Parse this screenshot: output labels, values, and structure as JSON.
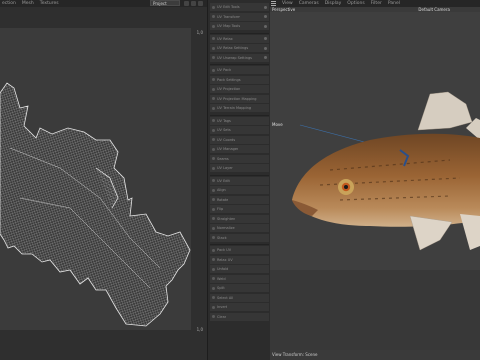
{
  "uv_editor": {
    "menu": [
      "ection",
      "Mesh",
      "Textures"
    ],
    "project_select": "Project",
    "corner_labels": {
      "top_right": "1,0",
      "bottom_right": "1,0"
    }
  },
  "side_panel": {
    "items": [
      "UV Edit Tools",
      "UV Transform",
      "UV Map Tools",
      "UV Relax",
      "UV Relax Settings",
      "UV Unwrap Settings",
      "UV Pack",
      "Pack Settings",
      "UV Projection",
      "UV Projection Mapping",
      "UV Terrain Mapping",
      "UV Tags",
      "UV Sets",
      "UV Coords",
      "UV Manager",
      "Seams",
      "UV Layer",
      "UV Edit",
      "Align",
      "Rotate",
      "Flip",
      "Straighten",
      "Normalize",
      "Stack",
      "Pack UV",
      "Relax UV",
      "Unfold",
      "Weld",
      "Split",
      "Select All",
      "Invert",
      "Clear"
    ]
  },
  "viewport": {
    "menu": [
      "View",
      "Cameras",
      "Display",
      "Options",
      "Filter",
      "Panel"
    ],
    "view_name": "Perspective",
    "camera_name": "Default Camera",
    "move_label": "Move",
    "status": "View Transform: Scene"
  },
  "colors": {
    "uv_wire": "#d8d8d8",
    "fish_body": "#8a5a2e",
    "fish_belly": "#c9a27a",
    "fish_fin": "#d8cfc2"
  }
}
